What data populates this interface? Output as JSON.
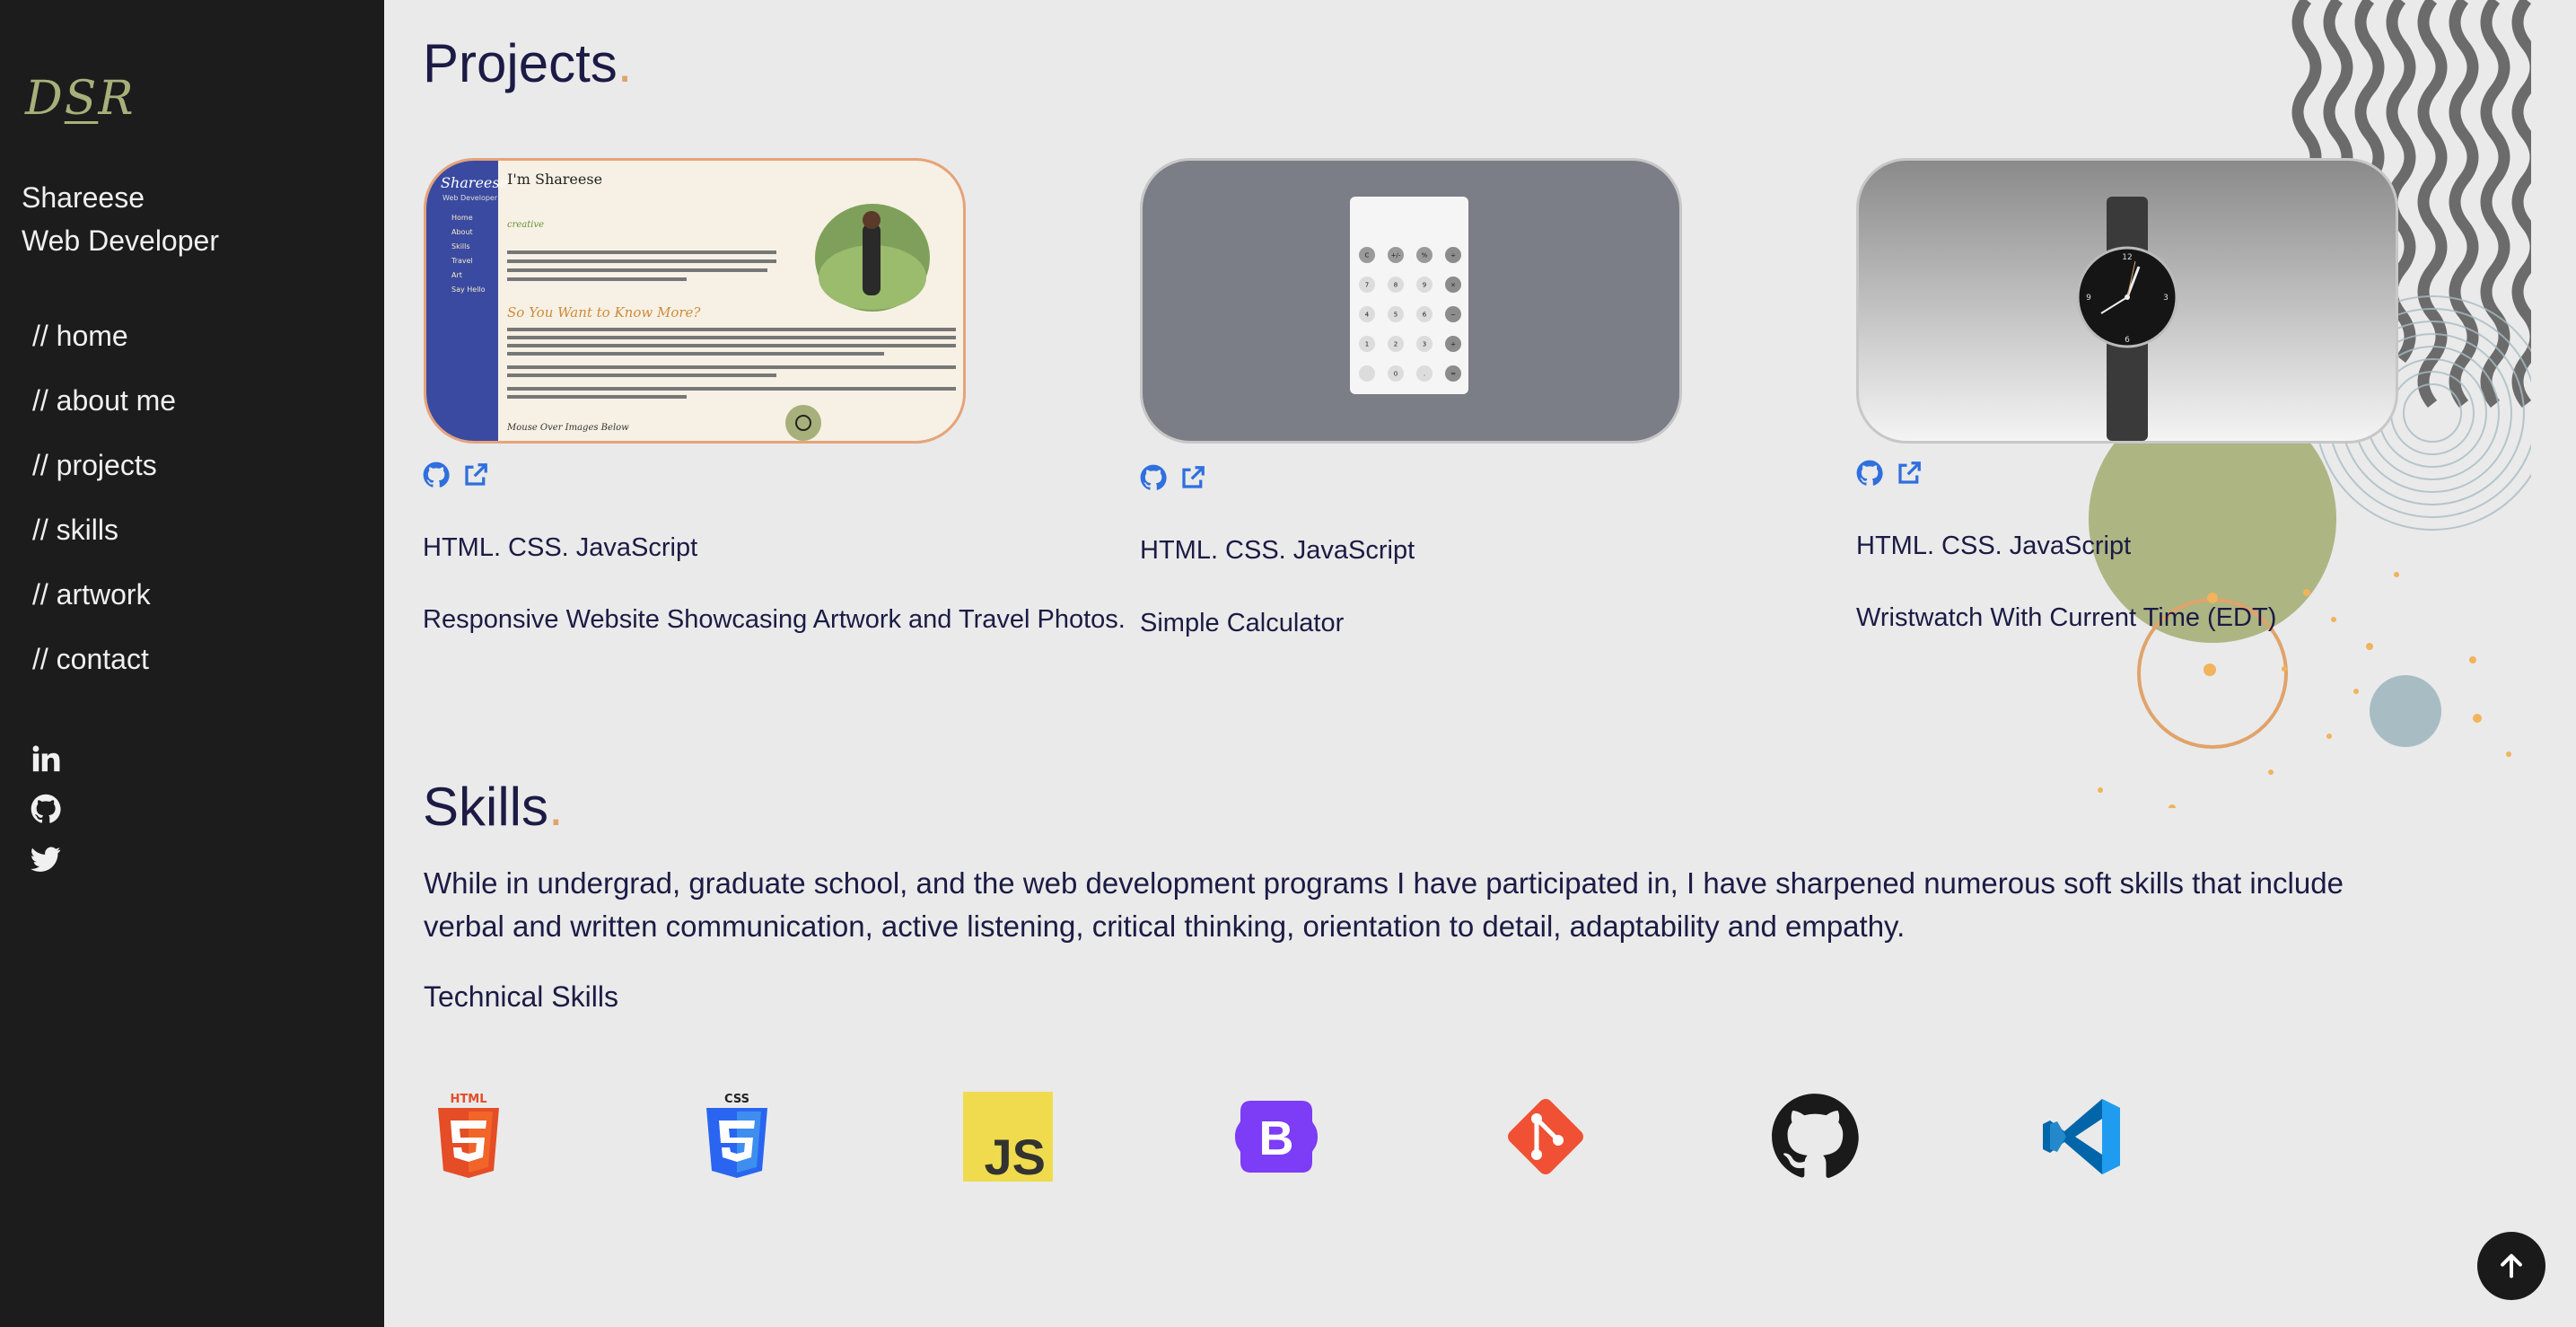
{
  "sidebar": {
    "logo": {
      "prefix": "D",
      "underlined": "S",
      "suffix": "R"
    },
    "name": "Shareese",
    "role": "Web Developer",
    "nav": [
      {
        "label": "// home"
      },
      {
        "label": "// about me"
      },
      {
        "label": "// projects"
      },
      {
        "label": "// skills"
      },
      {
        "label": "// artwork"
      },
      {
        "label": "// contact"
      }
    ],
    "social": [
      "linkedin-icon",
      "github-icon",
      "twitter-icon"
    ]
  },
  "projects": {
    "title": "Projects",
    "title_dot": ".",
    "items": [
      {
        "tech": "HTML. CSS. JavaScript",
        "description": "Responsive Website Showcasing Artwork and Travel Photos.",
        "preview": {
          "brand": "Shareese",
          "brand_sub": "Web Developer",
          "heading": "I'm Shareese",
          "tagline": "creative",
          "subheading": "So You Want to Know More?",
          "nav": [
            "Home",
            "About",
            "Skills",
            "Travel",
            "Art",
            "Say Hello"
          ],
          "footer": "Mouse Over Images Below"
        }
      },
      {
        "tech": "HTML. CSS. JavaScript",
        "description": "Simple Calculator",
        "preview": {
          "keys": [
            "C",
            "+/-",
            "%",
            "÷",
            "7",
            "8",
            "9",
            "×",
            "4",
            "5",
            "6",
            "−",
            "1",
            "2",
            "3",
            "+",
            "",
            "0",
            ".",
            "="
          ]
        }
      },
      {
        "tech": "HTML. CSS. JavaScript",
        "description": "Wristwatch With Current Time (EDT)",
        "preview": {
          "clock_numbers": [
            "12",
            "3",
            "6",
            "9"
          ]
        }
      }
    ]
  },
  "skills": {
    "title": "Skills",
    "title_dot": ".",
    "paragraph": "While in undergrad, graduate school, and the web development programs I have participated in, I have sharpened numerous soft skills that include verbal and written communication, active listening, critical thinking, orientation to detail, adaptability and empathy.",
    "technical_title": "Technical Skills",
    "icons": [
      {
        "name": "html5-icon",
        "label": "HTML",
        "color": "#e44d26"
      },
      {
        "name": "css3-icon",
        "label": "CSS",
        "color": "#2965f1"
      },
      {
        "name": "javascript-icon",
        "label": "JS",
        "color": "#f0db4f"
      },
      {
        "name": "bootstrap-icon",
        "label": "B",
        "color": "#7952b3"
      },
      {
        "name": "git-icon",
        "label": "",
        "color": "#f05033"
      },
      {
        "name": "github-icon",
        "label": "",
        "color": "#1a1a1a"
      },
      {
        "name": "vscode-icon",
        "label": "",
        "color": "#3a8bd6"
      }
    ]
  },
  "colors": {
    "sidebar": "#1c1c1c",
    "background": "#eaeaea",
    "accent_orange": "#e0a36a",
    "logo_green": "#a7b07a",
    "link_blue": "#2f6fde"
  }
}
